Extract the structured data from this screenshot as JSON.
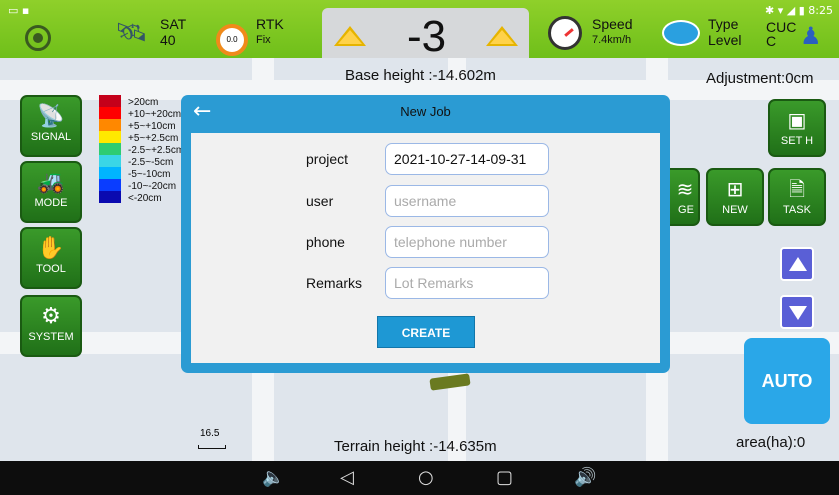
{
  "status_bar": {
    "sat_label": "SAT",
    "sat_value": "40",
    "rtk_label": "RTK",
    "rtk_value": "Fix",
    "gauge_value": "0.0",
    "center_value": "-3",
    "speed_label": "Speed",
    "speed_value": "7.4km/h",
    "type_label": "Type",
    "type_value": "CUC",
    "level_label": "Level",
    "level_value": "C",
    "clock": "8:25"
  },
  "map": {
    "base_height": "Base height :-14.602m",
    "adjustment": "Adjustment:0cm",
    "terrain_height": "Terrain height :-14.635m",
    "area": "area(ha):0",
    "scale_value": "16.5"
  },
  "legend": [
    {
      "text": ">20cm",
      "color": "#c4001a"
    },
    {
      "text": "+10~+20cm",
      "color": "#ff0000"
    },
    {
      "text": "+5~+10cm",
      "color": "#ff8800"
    },
    {
      "text": "+5~+2.5cm",
      "color": "#ffe800"
    },
    {
      "text": "-2.5~+2.5cm",
      "color": "#2ecc71"
    },
    {
      "text": "-2.5~-5cm",
      "color": "#3ad6e6"
    },
    {
      "text": "-5~-10cm",
      "color": "#00b4ff"
    },
    {
      "text": "-10~-20cm",
      "color": "#0a3dff"
    },
    {
      "text": "<-20cm",
      "color": "#0a0ab0"
    }
  ],
  "left_menu": [
    {
      "label": "SIGNAL",
      "icon": "antenna-icon"
    },
    {
      "label": "MODE",
      "icon": "tractor-icon"
    },
    {
      "label": "TOOL",
      "icon": "hand-tool-icon"
    },
    {
      "label": "SYSTEM",
      "icon": "gear-icon"
    }
  ],
  "right_menu": {
    "set_h": "SET H",
    "manage_partial": "GE",
    "new": "NEW",
    "task": "TASK",
    "auto": "AUTO"
  },
  "dialog": {
    "title": "New Job",
    "project_label": "project",
    "project_value": "2021-10-27-14-09-31",
    "user_label": "user",
    "user_placeholder": "username",
    "phone_label": "phone",
    "phone_placeholder": "telephone number",
    "remarks_label": "Remarks",
    "remarks_placeholder": "Lot Remarks",
    "create_label": "CREATE"
  },
  "colors": {
    "topbar": "#7ec624",
    "button_green": "#2a8a22",
    "dialog_blue": "#2b9bd3",
    "auto_blue": "#2aa7e8"
  }
}
